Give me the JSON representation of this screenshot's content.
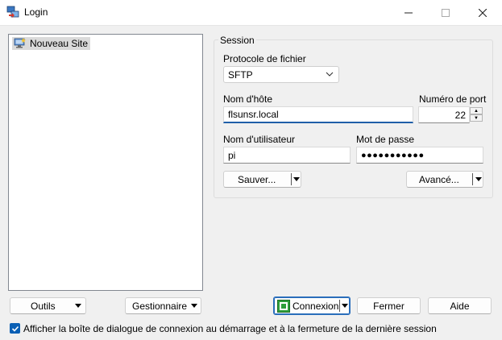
{
  "window": {
    "title": "Login"
  },
  "sites": [
    {
      "label": "Nouveau Site"
    }
  ],
  "session": {
    "legend": "Session",
    "protocol_label": "Protocole de fichier",
    "protocol_value": "SFTP",
    "host_label": "Nom d'hôte",
    "host_value": "flsunsr.local",
    "port_label": "Numéro de port",
    "port_value": "22",
    "user_label": "Nom d'utilisateur",
    "user_value": "pi",
    "password_label": "Mot de passe",
    "password_value": "●●●●●●●●●●●",
    "save_label": "Sauver...",
    "advanced_label": "Avancé..."
  },
  "footer": {
    "tools_label": "Outils",
    "manager_label": "Gestionnaire",
    "connect_label": "Connexion",
    "close_label": "Fermer",
    "help_label": "Aide",
    "show_dialog_label": "Afficher la boîte de dialogue de connexion au démarrage et à la fermeture de la dernière session",
    "show_dialog_checked": true
  },
  "colors": {
    "accent": "#0a5fb4",
    "connect_icon": "#2e9e3a",
    "focus_underline": "#1f5fa8"
  }
}
